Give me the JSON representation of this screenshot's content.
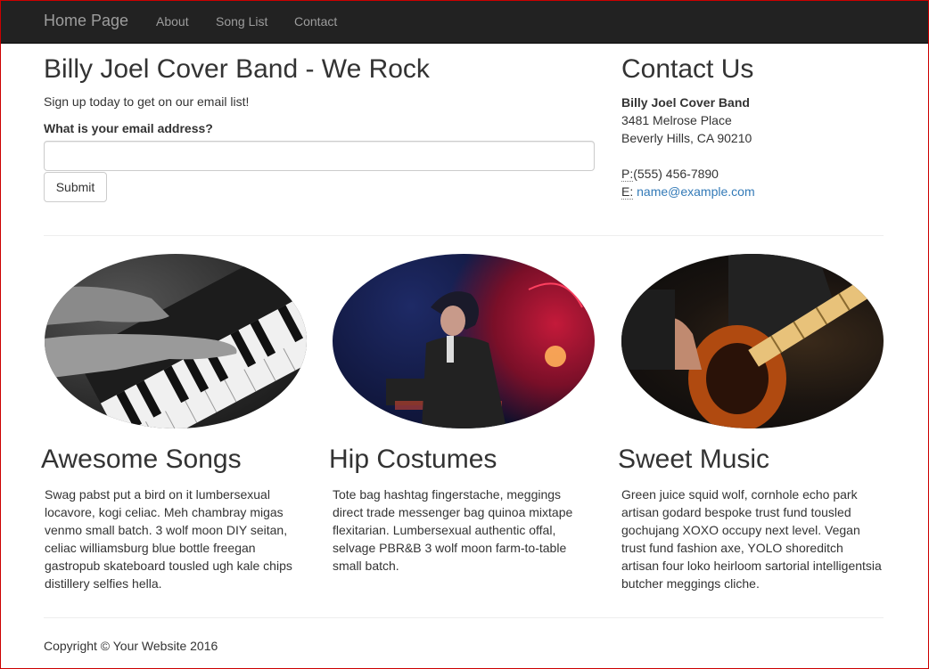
{
  "nav": {
    "brand": "Home Page",
    "links": [
      "About",
      "Song List",
      "Contact"
    ]
  },
  "signup": {
    "title": "Billy Joel Cover Band - We Rock",
    "text": "Sign up today to get on our email list!",
    "email_label": "What is your email address?",
    "email_value": "",
    "submit_label": "Submit"
  },
  "contact": {
    "title": "Contact Us",
    "name": "Billy Joel Cover Band",
    "street": "3481 Melrose Place",
    "city": "Beverly Hills, CA 90210",
    "phone_label": "P:",
    "phone": "(555) 456-7890",
    "email_label": "E:",
    "email": "name@example.com"
  },
  "features": [
    {
      "title": "Awesome Songs",
      "text": "Swag pabst put a bird on it lumbersexual locavore, kogi celiac. Meh chambray migas venmo small batch. 3 wolf moon DIY seitan, celiac williamsburg blue bottle freegan gastropub skateboard tousled ugh kale chips distillery selfies hella."
    },
    {
      "title": "Hip Costumes",
      "text": "Tote bag hashtag fingerstache, meggings direct trade messenger bag quinoa mixtape flexitarian. Lumbersexual authentic offal, selvage PBR&B 3 wolf moon farm-to-table small batch."
    },
    {
      "title": "Sweet Music",
      "text": "Green juice squid wolf, cornhole echo park artisan godard bespoke trust fund tousled gochujang XOXO occupy next level. Vegan trust fund fashion axe, YOLO shoreditch artisan four loko heirloom sartorial intelligentsia butcher meggings cliche."
    }
  ],
  "footer": {
    "copyright": "Copyright © Your Website 2016"
  },
  "colors": {
    "navbar_bg": "#222222",
    "nav_text": "#9d9d9d",
    "link": "#337ab7"
  }
}
